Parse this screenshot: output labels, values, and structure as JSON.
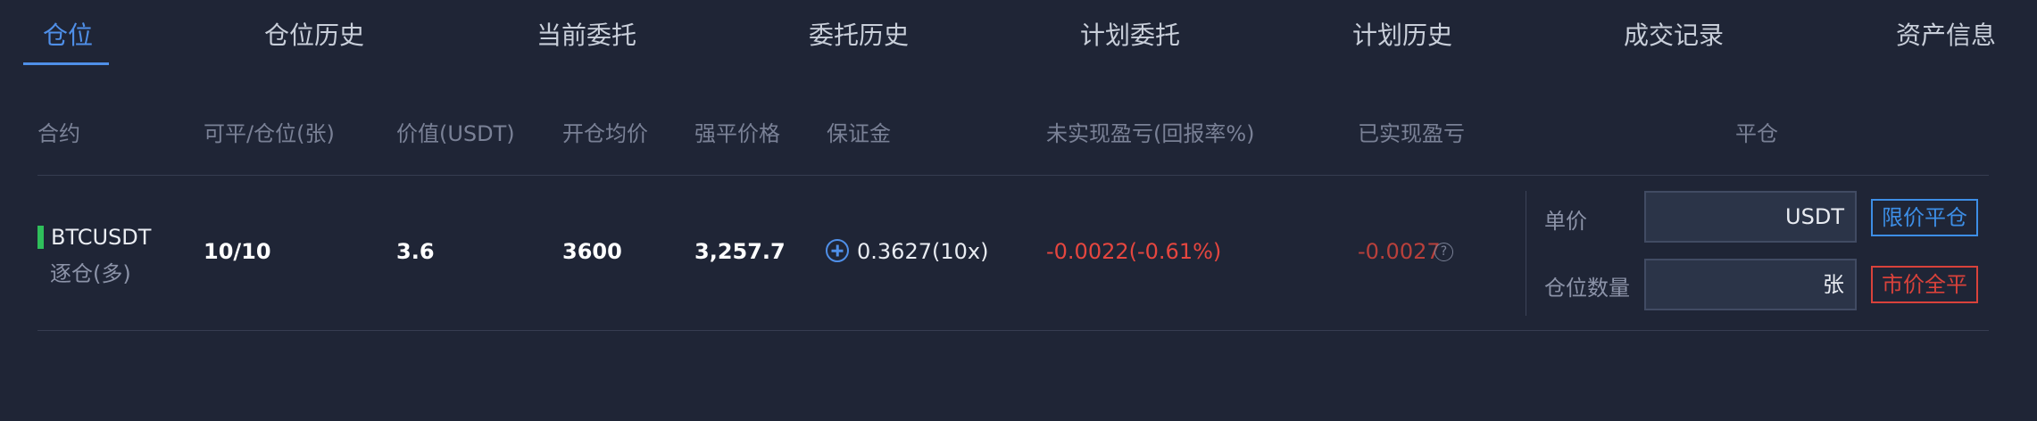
{
  "tabs": [
    {
      "label": "仓位",
      "active": true
    },
    {
      "label": "仓位历史"
    },
    {
      "label": "当前委托"
    },
    {
      "label": "委托历史"
    },
    {
      "label": "计划委托"
    },
    {
      "label": "计划历史"
    },
    {
      "label": "成交记录"
    },
    {
      "label": "资产信息"
    }
  ],
  "columns": {
    "contract": "合约",
    "closable": "可平/仓位(张)",
    "value": "价值(USDT)",
    "avg_price": "开仓均价",
    "liq_price": "强平价格",
    "margin": "保证金",
    "unrealized": "未实现盈亏(回报率%)",
    "realized": "已实现盈亏",
    "close": "平仓"
  },
  "position": {
    "symbol": "BTCUSDT",
    "mode": "逐仓(多)",
    "closable": "10/10",
    "value": "3.6",
    "avg_price": "3600",
    "liq_price": "3,257.7",
    "margin": "0.3627(10x)",
    "unrealized": "-0.0022(-0.61%)",
    "realized": "-0.0027"
  },
  "close_form": {
    "price_label": "单价",
    "price_unit": "USDT",
    "qty_label": "仓位数量",
    "qty_unit": "张",
    "limit_button": "限价平仓",
    "market_button": "市价全平"
  },
  "colors": {
    "accent": "#4f8fe8",
    "negative": "#e5463f",
    "long": "#2fbf5b"
  }
}
